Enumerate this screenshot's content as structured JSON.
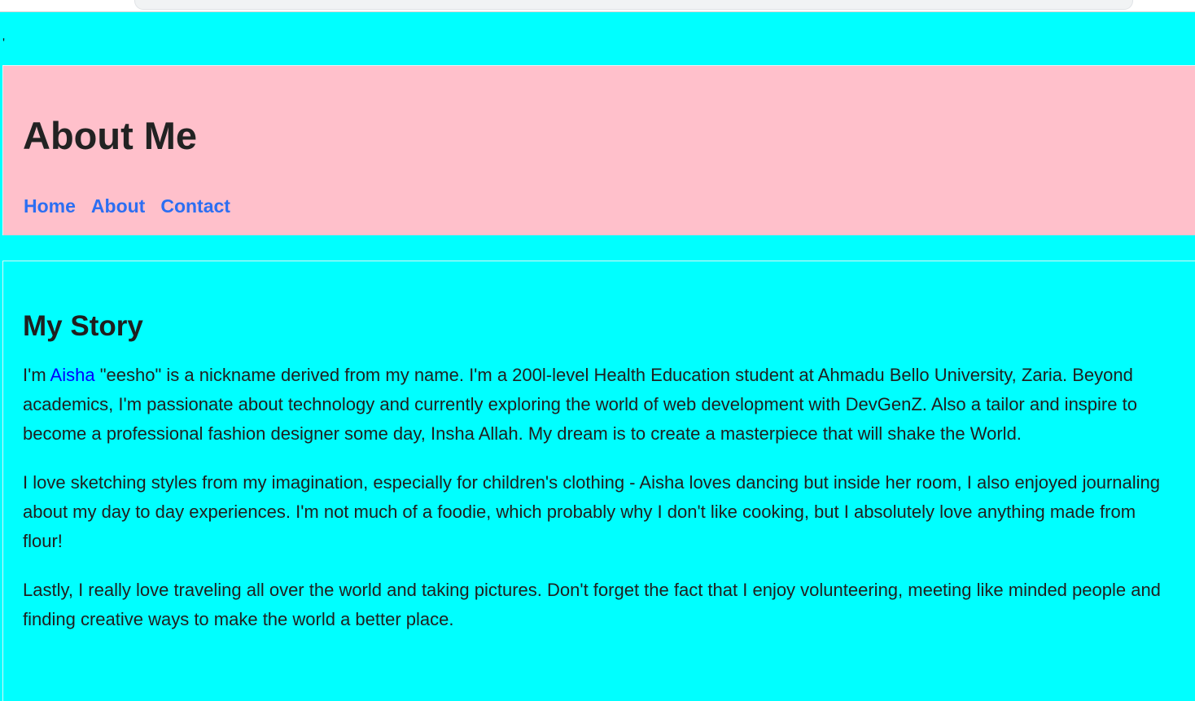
{
  "colors": {
    "page_background": "#00FFFF",
    "header_background": "#FFC0CB",
    "nav_link": "#2C6EF2",
    "name_link": "#0000FF",
    "text": "#1F1F1F"
  },
  "stray_text": "'",
  "header": {
    "title": "About Me",
    "nav": [
      {
        "label": "Home"
      },
      {
        "label": "About"
      },
      {
        "label": "Contact"
      }
    ]
  },
  "main": {
    "section_title": "My Story",
    "paragraph1": {
      "prefix": "I'm ",
      "name_link": "Aisha",
      "rest": " \"eesho\" is a nickname derived from my name. I'm a 200l-level Health Education student at Ahmadu Bello University, Zaria. Beyond academics, I'm passionate about technology and currently exploring the world of web development with DevGenZ. Also a tailor and inspire to become a professional fashion designer some day, Insha Allah. My dream is to create a masterpiece that will shake the World."
    },
    "paragraph2": "I love sketching styles from my imagination, especially for children's clothing - Aisha loves dancing but inside her room, I also enjoyed journaling about my day to day experiences. I'm not much of a foodie, which probably why I don't like cooking, but I absolutely love anything made from flour!",
    "paragraph3": "Lastly, I really love traveling all over the world and taking pictures. Don't forget the fact that I enjoy volunteering, meeting like minded people and finding creative ways to make the world a better place."
  }
}
